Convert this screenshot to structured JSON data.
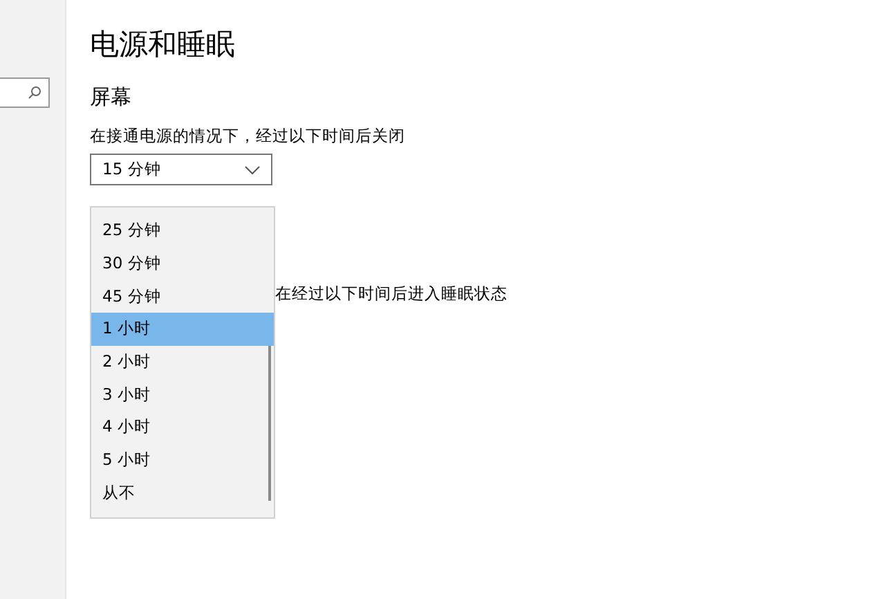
{
  "page": {
    "title": "电源和睡眠"
  },
  "screen_section": {
    "heading": "屏幕",
    "label": "在接通电源的情况下，经过以下时间后关闭",
    "dropdown": {
      "value": "15 分钟",
      "expanded": true
    }
  },
  "sleep_section": {
    "label": "在经过以下时间后进入睡眠状态"
  },
  "dropdown_list": {
    "options": [
      {
        "label": "25 分钟",
        "selected": false
      },
      {
        "label": "30 分钟",
        "selected": false
      },
      {
        "label": "45 分钟",
        "selected": false
      },
      {
        "label": "1 小时",
        "selected": true
      },
      {
        "label": "2 小时",
        "selected": false
      },
      {
        "label": "3 小时",
        "selected": false
      },
      {
        "label": "4 小时",
        "selected": false
      },
      {
        "label": "5 小时",
        "selected": false
      },
      {
        "label": "从不",
        "selected": false
      }
    ]
  }
}
